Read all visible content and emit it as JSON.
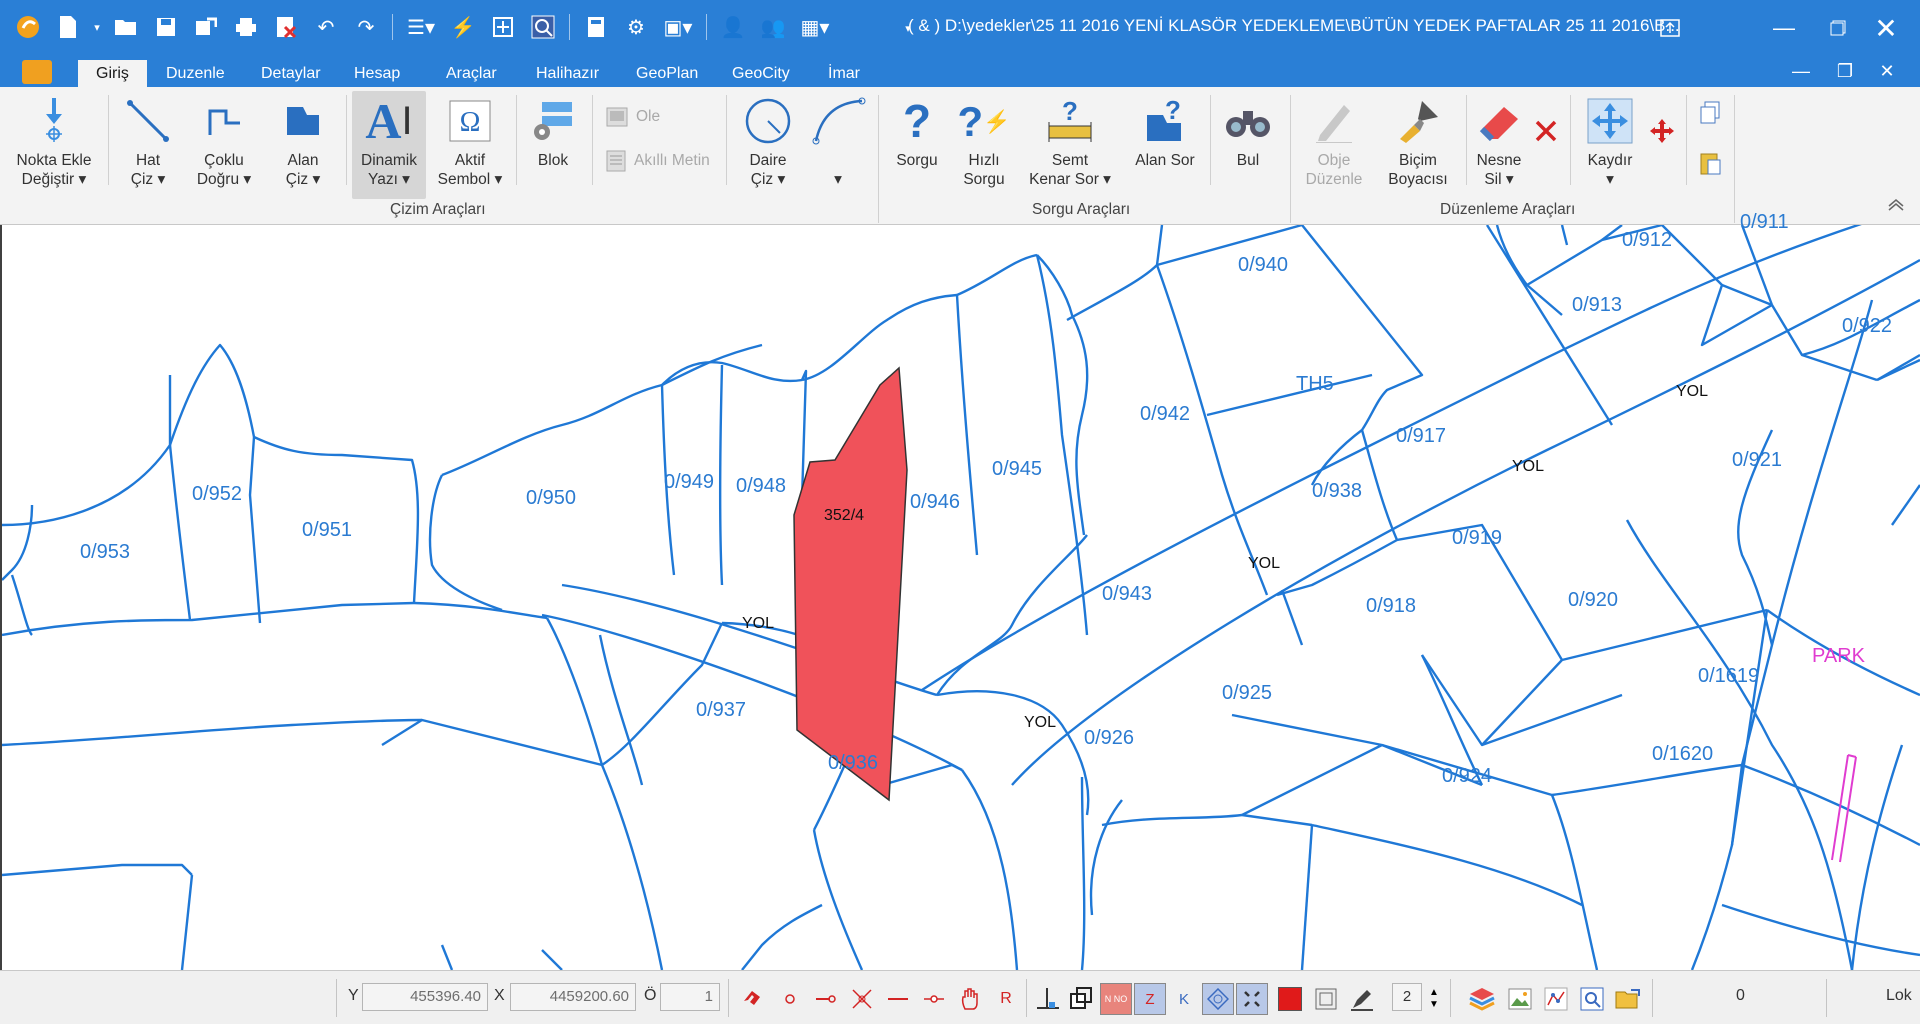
{
  "window": {
    "title": "( & ) D:\\yedekler\\25 11 2016  YENİ KLASÖR YEDEKLEME\\BÜTÜN YEDEK PAFTALAR 25 11 2016\\B..."
  },
  "ribbon_tabs": [
    "Giriş",
    "Duzenle",
    "Detaylar",
    "Hesap",
    "Araçlar",
    "Halihazır",
    "GeoPlan",
    "GeoCity",
    "İmar"
  ],
  "ribbon": {
    "nokta_ekle": [
      "Nokta Ekle",
      "Değiştir ▾"
    ],
    "hat_ciz": [
      "Hat",
      "Çiz ▾"
    ],
    "coklu_dogru": [
      "Çoklu",
      "Doğru ▾"
    ],
    "alan_ciz": [
      "Alan",
      "Çiz ▾"
    ],
    "dinamik_yazi": [
      "Dinamik",
      "Yazı ▾"
    ],
    "aktif_sembol": [
      "Aktif",
      "Sembol ▾"
    ],
    "blok": "Blok",
    "ole": "Ole",
    "akilli_metin": "Akıllı Metin",
    "daire_ciz": [
      "Daire",
      "Çiz ▾"
    ],
    "arc_dropdown": "▾",
    "sorgu": "Sorgu",
    "hizli_sorgu": [
      "Hızlı",
      "Sorgu"
    ],
    "semt_kenar_sor": [
      "Semt",
      "Kenar Sor ▾"
    ],
    "alan_sor": "Alan Sor",
    "bul": "Bul",
    "obje_duzenle": [
      "Obje",
      "Düzenle"
    ],
    "bicim_boyacisi": [
      "Biçim",
      "Boyacısı"
    ],
    "nesne_sil": [
      "Nesne",
      "Sil ▾"
    ],
    "kaydir": [
      "Kaydır",
      "▾"
    ],
    "groups": {
      "cizim": "Çizim Araçları",
      "sorgu": "Sorgu Araçları",
      "duzenleme": "Düzenleme Araçları"
    }
  },
  "map": {
    "parcels": [
      {
        "id": "p953",
        "label": "0/953"
      },
      {
        "id": "p952",
        "label": "0/952"
      },
      {
        "id": "p951",
        "label": "0/951"
      },
      {
        "id": "p950",
        "label": "0/950"
      },
      {
        "id": "p949",
        "label": "0/949"
      },
      {
        "id": "p948",
        "label": "0/948"
      },
      {
        "id": "p946",
        "label": "0/946"
      },
      {
        "id": "p945",
        "label": "0/945"
      },
      {
        "id": "p942",
        "label": "0/942"
      },
      {
        "id": "p943",
        "label": "0/943"
      },
      {
        "id": "p940",
        "label": "0/940"
      },
      {
        "id": "pth5",
        "label": "TH5"
      },
      {
        "id": "p917",
        "label": "0/917"
      },
      {
        "id": "p938",
        "label": "0/938"
      },
      {
        "id": "p919",
        "label": "0/919"
      },
      {
        "id": "p918",
        "label": "0/918"
      },
      {
        "id": "p920",
        "label": "0/920"
      },
      {
        "id": "p921",
        "label": "0/921"
      },
      {
        "id": "p912",
        "label": "0/912"
      },
      {
        "id": "p913",
        "label": "0/913"
      },
      {
        "id": "p922",
        "label": "0/922"
      },
      {
        "id": "p911",
        "label": "0/911"
      },
      {
        "id": "p937",
        "label": "0/937"
      },
      {
        "id": "p936",
        "label": "0/936"
      },
      {
        "id": "p926",
        "label": "0/926"
      },
      {
        "id": "p925",
        "label": "0/925"
      },
      {
        "id": "p924",
        "label": "0/924"
      },
      {
        "id": "p1619",
        "label": "0/1619"
      },
      {
        "id": "p1620",
        "label": "0/1620"
      }
    ],
    "selected_parcel": "352/4",
    "road_label": "YOL",
    "park_label": "PARK",
    "colors": {
      "parcel_line": "#1f78d6",
      "parcel_text": "#2b7bd1",
      "selection_fill": "#f0525a",
      "park": "#e03cd0"
    }
  },
  "statusbar": {
    "y_label": "Y",
    "y_value": "455396.40",
    "x_label": "X",
    "x_value": "4459200.60",
    "o_label": "Ö",
    "o_value": "1",
    "snap_r": "R",
    "snap_nno": "N NO",
    "snap_z": "Z",
    "snap_k": "K",
    "spin_value": "2",
    "count_value": "0",
    "mode_text": "Lok"
  }
}
